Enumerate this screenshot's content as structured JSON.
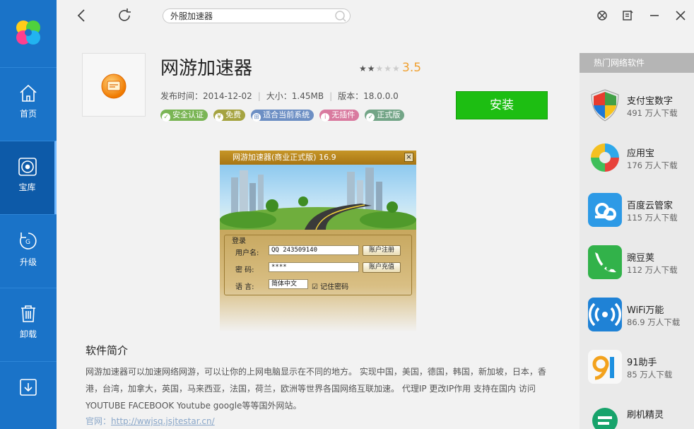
{
  "nav": [
    {
      "label": "首页",
      "icon": "home-icon"
    },
    {
      "label": "宝库",
      "icon": "disc-icon",
      "active": true
    },
    {
      "label": "升级",
      "icon": "upgrade-icon"
    },
    {
      "label": "卸载",
      "icon": "trash-icon"
    },
    {
      "label": "",
      "icon": "download-icon"
    }
  ],
  "search": {
    "value": "外服加速器"
  },
  "app": {
    "title": "网游加速器",
    "rating": "3.5",
    "release_label": "发布时间：2014-12-02",
    "size_label": "大小：1.45MB",
    "version_label": "版本：18.0.0.0",
    "install_label": "安装",
    "badges": [
      {
        "label": "安全认证",
        "color": "#7ab555"
      },
      {
        "label": "免费",
        "color": "#a5a340"
      },
      {
        "label": "适合当前系统",
        "color": "#6d8fc4"
      },
      {
        "label": "无插件",
        "color": "#d97a9f"
      },
      {
        "label": "正式版",
        "color": "#73a587"
      }
    ]
  },
  "screenshot": {
    "title": "网游加速器(商业正式版) 16.9",
    "group_label": "登录",
    "user_label": "用户名:",
    "user_value": "QQ 243509140",
    "register_btn": "账户注册",
    "pass_label": "密  码:",
    "pass_value": "****",
    "recharge_btn": "账户充值",
    "lang_label": "语  言:",
    "lang_value": "简体中文",
    "remember_label": "记住密码"
  },
  "intro": {
    "title": "软件简介",
    "text": "网游加速器可以加速网络网游，可以让你的上网电脑显示在不同的地方。 实现中国，美国，德国，韩国，新加坡，日本，香港，台湾，加拿大，英国，马来西亚，法国，荷兰，欧洲等世界各国网络互联加速。 代理IP 更改IP作用 支持在国内 访问 YOUTUBE FACEBOOK Youtube google等等国外网站。",
    "site_label": "官网：",
    "site_url": "http://wwjsq.jsjtestar.cn/"
  },
  "hot": {
    "header": "热门网络软件",
    "items": [
      {
        "name": "支付宝数字",
        "downloads": "491 万人下载",
        "icon": "shield-icon"
      },
      {
        "name": "应用宝",
        "downloads": "176 万人下载",
        "icon": "yingyongbao-icon"
      },
      {
        "name": "百度云管家",
        "downloads": "115 万人下载",
        "icon": "baidu-cloud-icon"
      },
      {
        "name": "豌豆荚",
        "downloads": "112 万人下载",
        "icon": "wandoujia-icon"
      },
      {
        "name": "WiFi万能",
        "downloads": "86.9 万人下载",
        "icon": "wifi-icon"
      },
      {
        "name": "91助手",
        "downloads": "85 万人下载",
        "icon": "91-icon"
      },
      {
        "name": "刷机精灵",
        "downloads": "",
        "icon": "shuaji-icon"
      }
    ]
  }
}
